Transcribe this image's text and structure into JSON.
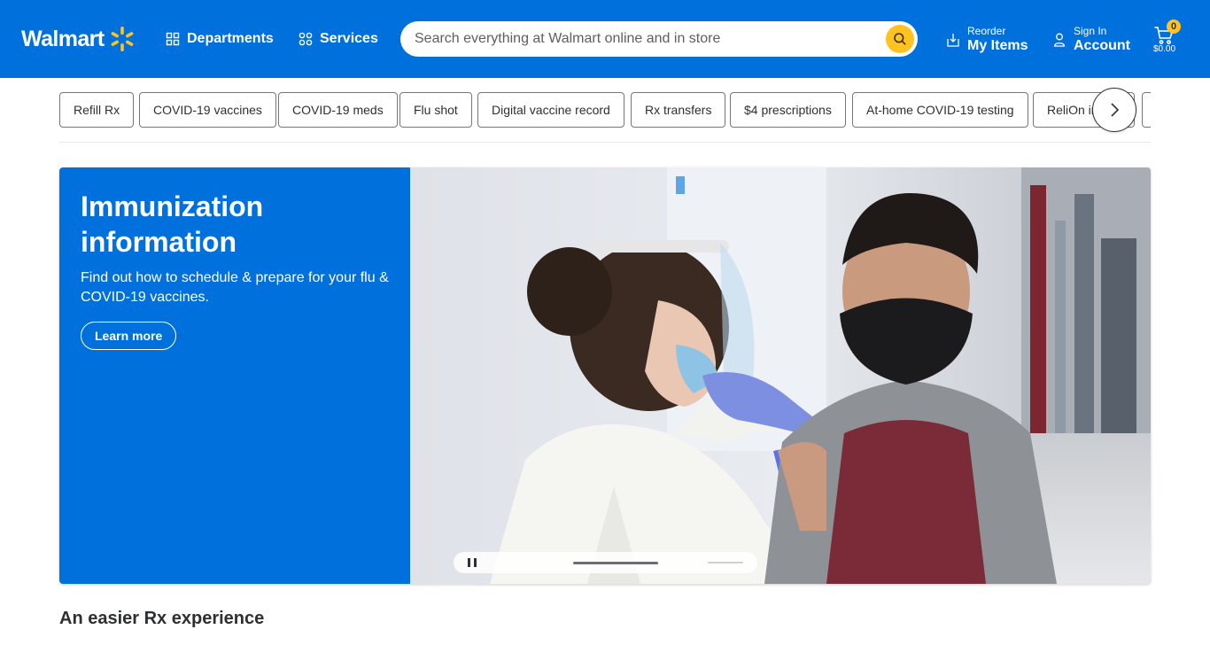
{
  "header": {
    "logo_text": "Walmart",
    "departments_label": "Departments",
    "services_label": "Services",
    "search_placeholder": "Search everything at Walmart online and in store",
    "reorder_small": "Reorder",
    "reorder_big": "My Items",
    "signin_small": "Sign In",
    "signin_big": "Account",
    "cart_count": "0",
    "cart_total": "$0.00"
  },
  "chips": [
    {
      "label": "Refill Rx"
    },
    {
      "label": "COVID-19 vaccines"
    },
    {
      "label": "COVID-19 meds"
    },
    {
      "label": "Flu shot"
    },
    {
      "label": "Digital vaccine record"
    },
    {
      "label": "Rx transfers"
    },
    {
      "label": "$4 prescriptions"
    },
    {
      "label": "At-home COVID-19 testing"
    },
    {
      "label": "ReliOn insulin"
    }
  ],
  "hero": {
    "title": "Immunization information",
    "subtitle": "Find out how to schedule & prepare for your flu & COVID-19 vaccines.",
    "button_label": "Learn more"
  },
  "section": {
    "title": "An easier Rx experience"
  },
  "colors": {
    "brand_blue": "#0071dc",
    "spark_yellow": "#ffc220"
  },
  "icons": {
    "departments": "grid-icon",
    "services": "services-grid-icon",
    "search": "search-icon",
    "reorder": "reorder-icon",
    "account": "person-icon",
    "cart": "cart-icon",
    "next": "chevron-right-icon"
  }
}
